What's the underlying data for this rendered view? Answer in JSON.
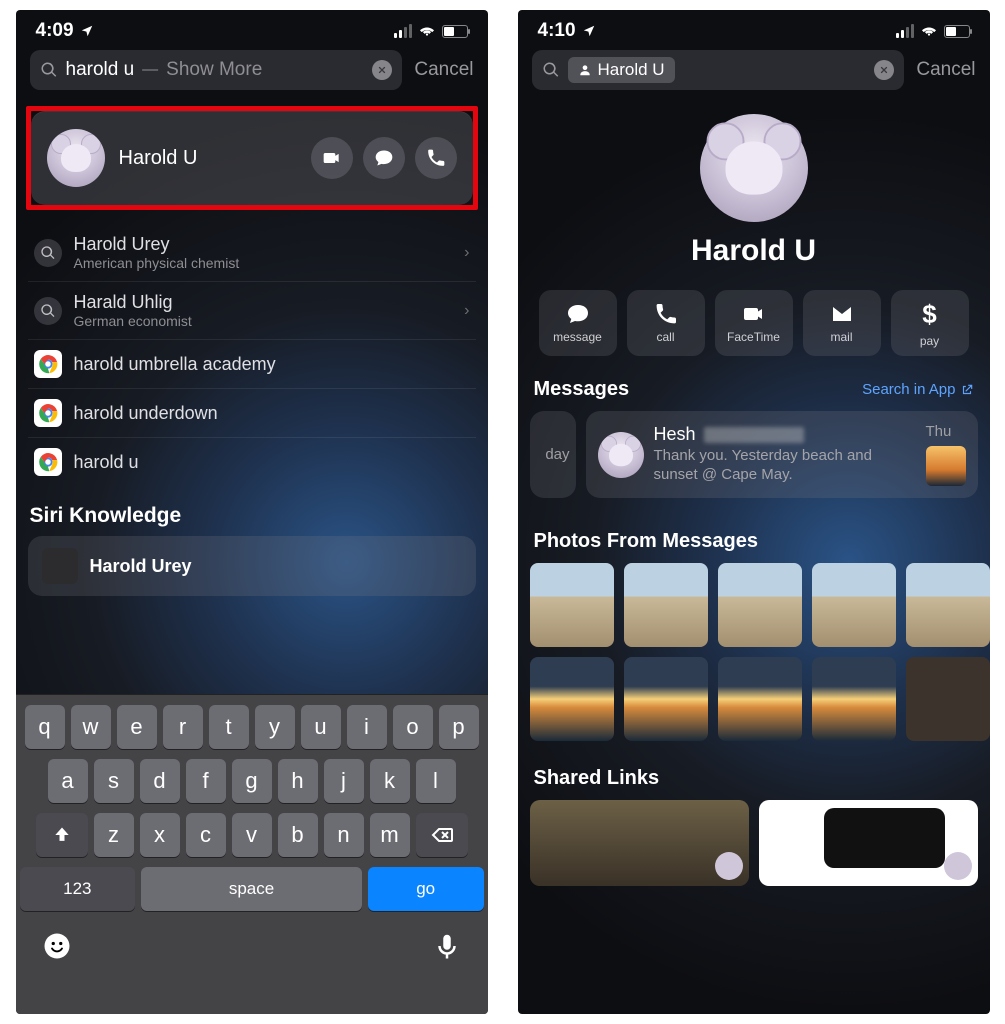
{
  "left": {
    "status": {
      "time": "4:09"
    },
    "search": {
      "query": "harold u",
      "show_more": "Show More",
      "cancel": "Cancel"
    },
    "top_contact": {
      "name": "Harold U"
    },
    "siri_results": [
      {
        "title": "Harold Urey",
        "subtitle": "American physical chemist"
      },
      {
        "title": "Harald Uhlig",
        "subtitle": "German economist"
      }
    ],
    "web_results": [
      "harold umbrella academy",
      "harold underdown",
      "harold u"
    ],
    "siri_section": "Siri Knowledge",
    "siri_card": {
      "title": "Harold Urey"
    },
    "keyboard": {
      "rows": [
        [
          "q",
          "w",
          "e",
          "r",
          "t",
          "y",
          "u",
          "i",
          "o",
          "p"
        ],
        [
          "a",
          "s",
          "d",
          "f",
          "g",
          "h",
          "j",
          "k",
          "l"
        ],
        [
          "z",
          "x",
          "c",
          "v",
          "b",
          "n",
          "m"
        ]
      ],
      "num": "123",
      "space": "space",
      "go": "go"
    }
  },
  "right": {
    "status": {
      "time": "4:10"
    },
    "search": {
      "token": "Harold U",
      "cancel": "Cancel"
    },
    "contact": {
      "name": "Harold U"
    },
    "actions": {
      "message": "message",
      "call": "call",
      "facetime": "FaceTime",
      "mail": "mail",
      "pay": "pay"
    },
    "messages": {
      "title": "Messages",
      "search_link": "Search in App",
      "peek": "day",
      "conv": {
        "name": "Hesh",
        "body": "Thank you. Yesterday beach and sunset @ Cape May.",
        "day": "Thu"
      }
    },
    "photos_title": "Photos From Messages",
    "shared_links_title": "Shared Links"
  }
}
